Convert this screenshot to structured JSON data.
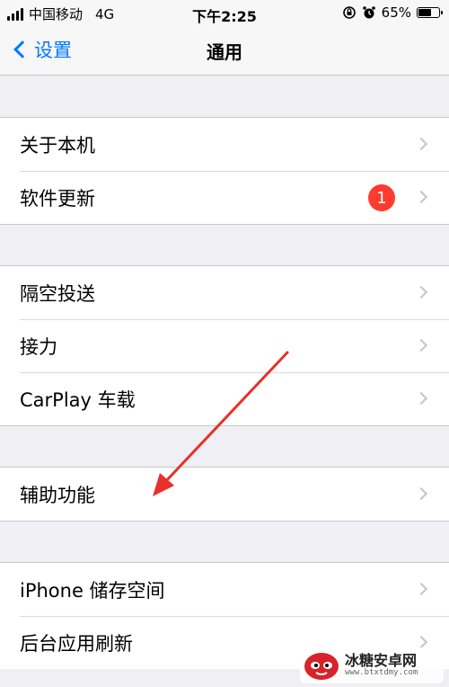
{
  "status_bar": {
    "carrier": "中国移动",
    "network": "4G",
    "time": "下午2:25",
    "battery_percent": "65%",
    "battery_level": 0.65
  },
  "nav": {
    "back_label": "设置",
    "title": "通用"
  },
  "groups": [
    {
      "rows": [
        {
          "label": "关于本机"
        },
        {
          "label": "软件更新",
          "badge": "1"
        }
      ]
    },
    {
      "rows": [
        {
          "label": "隔空投送"
        },
        {
          "label": "接力"
        },
        {
          "label": "CarPlay 车载"
        }
      ]
    },
    {
      "rows": [
        {
          "label": "辅助功能"
        }
      ]
    },
    {
      "rows": [
        {
          "label": "iPhone 储存空间"
        },
        {
          "label": "后台应用刷新"
        }
      ]
    }
  ],
  "watermark": {
    "name": "冰糖安卓网",
    "url": "www.btxtdmy.com"
  },
  "colors": {
    "accent": "#007aff",
    "badge": "#ff3b30",
    "annotation_arrow": "#e8302a",
    "background": "#efeff4"
  }
}
